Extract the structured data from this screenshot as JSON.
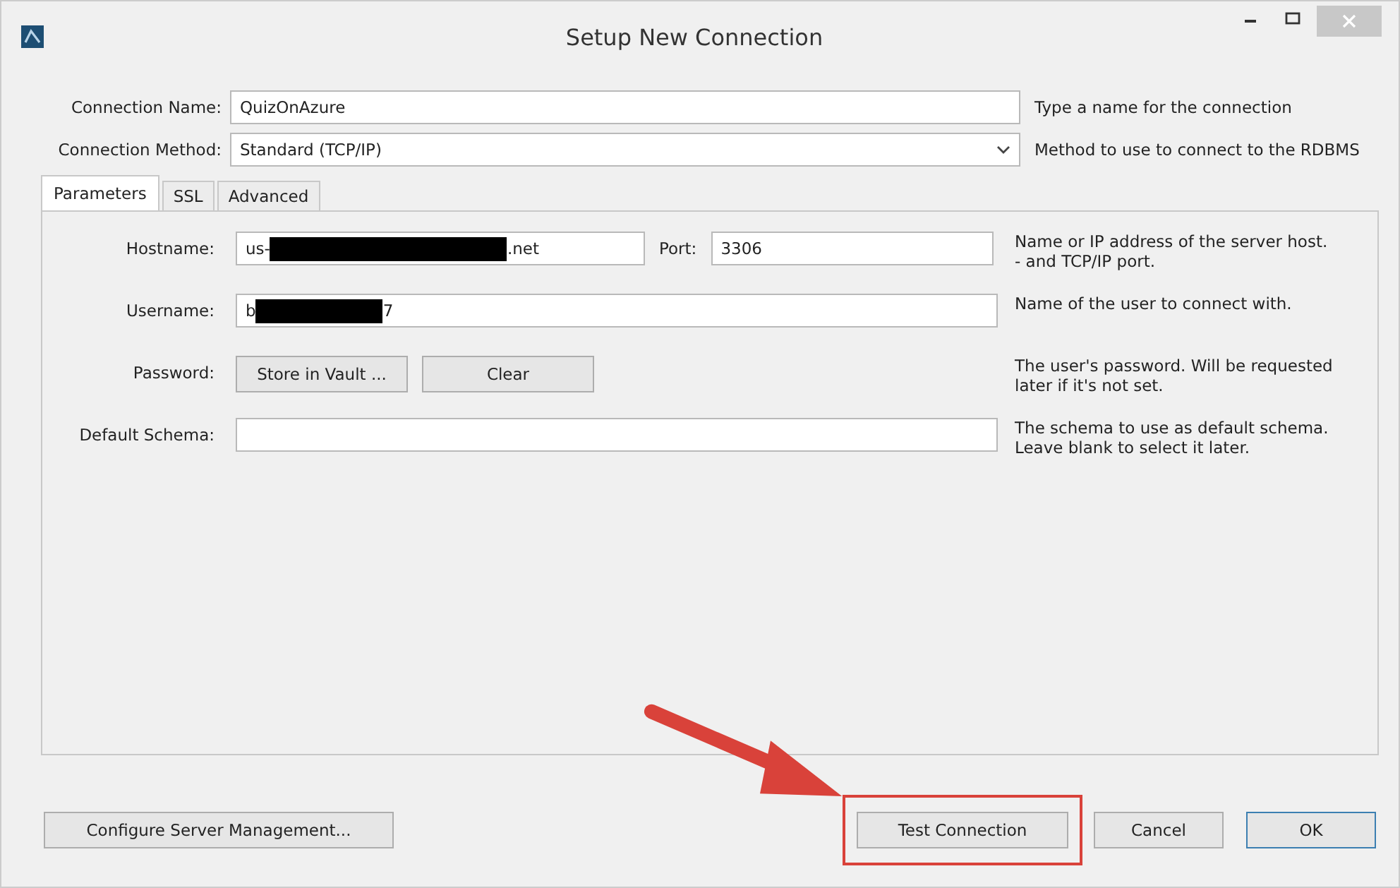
{
  "window": {
    "title": "Setup New Connection"
  },
  "form": [
    {
      "label": "Connection Name:",
      "kind": "text",
      "value": "QuizOnAzure",
      "hint": "Type a name for the connection"
    },
    {
      "label": "Connection Method:",
      "kind": "select",
      "value": "Standard (TCP/IP)",
      "hint": "Method to use to connect to the RDBMS"
    }
  ],
  "tabs": [
    {
      "label": "Parameters",
      "selected": true
    },
    {
      "label": "SSL",
      "selected": false
    },
    {
      "label": "Advanced",
      "selected": false
    }
  ],
  "parameters": [
    {
      "label": "Hostname:",
      "kind": "host",
      "value_start": "us-",
      "value_end": ".net",
      "redacted": true,
      "port_label": "Port:",
      "port": "3306",
      "hint": [
        "Name or IP address of the server host.",
        "- and TCP/IP port."
      ]
    },
    {
      "label": "Username:",
      "kind": "text",
      "value_start": "b",
      "value_end": "7",
      "redacted": true,
      "hint": [
        "Name of the user to connect with."
      ]
    },
    {
      "label": "Password:",
      "kind": "buttons",
      "buttons": [
        "Store in Vault ...",
        "Clear"
      ],
      "hint": [
        "The user's password. Will be requested",
        "later if it's not set."
      ]
    },
    {
      "label": "Default Schema:",
      "kind": "text",
      "hint": [
        "The schema to use as default schema.",
        "Leave blank to select it later."
      ]
    }
  ],
  "footer": {
    "left": "Configure Server Management...",
    "buttons": [
      {
        "label": "Test Connection",
        "highlighted": true
      },
      {
        "label": "Cancel",
        "highlighted": false
      },
      {
        "label": "OK",
        "highlighted": false
      }
    ]
  }
}
